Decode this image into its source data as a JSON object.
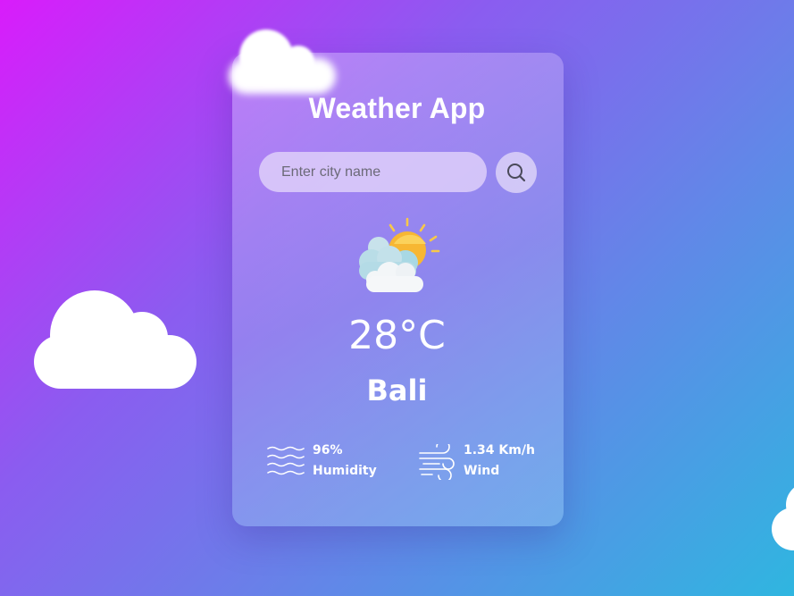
{
  "app": {
    "title": "Weather App"
  },
  "search": {
    "placeholder": "Enter city name",
    "button_icon": "search-icon"
  },
  "weather": {
    "condition_icon": "partly-cloudy-icon",
    "temperature": "28°C",
    "city": "Bali",
    "humidity": {
      "value": "96%",
      "label": "Humidity",
      "icon": "humidity-icon"
    },
    "wind": {
      "value": "1.34 Km/h",
      "label": "Wind",
      "icon": "wind-icon"
    }
  },
  "colors": {
    "gradient_start": "#d91cfb",
    "gradient_mid": "#6a7fe9",
    "gradient_end": "#2fb6e0",
    "text": "#ffffff"
  }
}
